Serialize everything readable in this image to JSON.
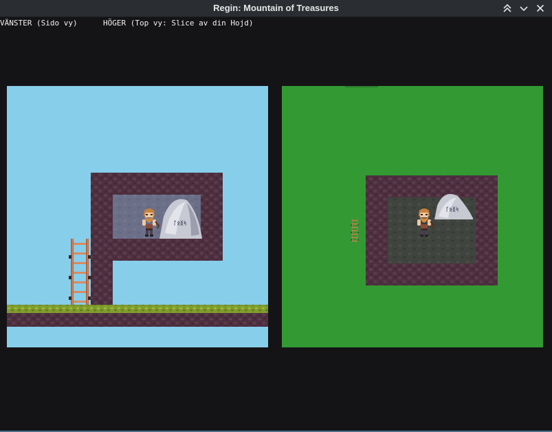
{
  "window": {
    "title": "Regin: Mountain of Treasures",
    "buttons": [
      "keep-above-icon",
      "minimize-icon",
      "close-icon"
    ]
  },
  "views": {
    "left_label": "VÄNSTER (Sido vy)",
    "right_label": "HÖGER (Top vy: Slice av din Hojd)"
  },
  "colors": {
    "window_bg": "#141416",
    "sky": "#87ceeb",
    "grass_top_view": "#339933",
    "rock": "#4e2f3f",
    "grass_strip": "#7f9c2d",
    "ladder": "#b8643c"
  },
  "scene": {
    "stone_glyphs": "ᚴᛟᛝᛋ"
  }
}
